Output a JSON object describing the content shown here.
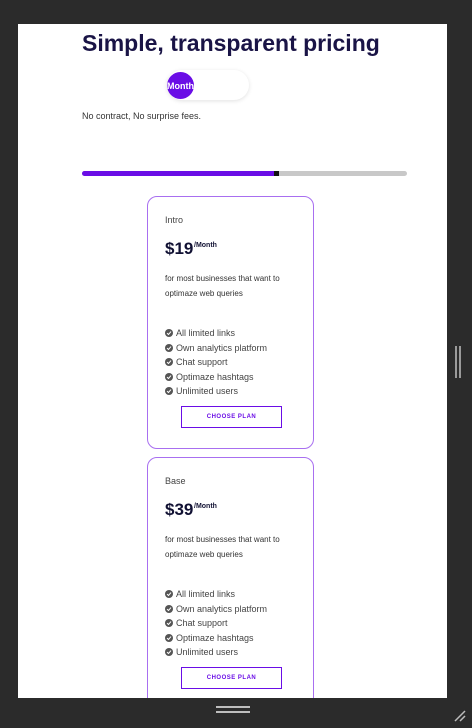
{
  "page": {
    "title": "Simple, transparent pricing",
    "toggle_label": "Month",
    "subtitle": "No contract, No surprise fees.",
    "slider_progress": 0.6
  },
  "plans": [
    {
      "name": "Intro",
      "price": "$19",
      "period": "/Month",
      "description": "for most businesses that want to optimaze web queries",
      "features": [
        "All limited links",
        "Own analytics platform",
        "Chat support",
        "Optimaze hashtags",
        "Unlimited users"
      ],
      "button_label": "CHOOSE PLAN"
    },
    {
      "name": "Base",
      "price": "$39",
      "period": "/Month",
      "description": "for most businesses that want to optimaze web queries",
      "features": [
        "All limited links",
        "Own analytics platform",
        "Chat support",
        "Optimaze hashtags",
        "Unlimited users"
      ],
      "button_label": "CHOOSE PLAN"
    }
  ],
  "colors": {
    "accent": "#6a0de6",
    "title": "#1a1446",
    "card_border": "#a86ff0",
    "track": "#c8c8c8"
  },
  "icons": {
    "feature": "check-circle-icon",
    "resize": "resize-grip-icon"
  }
}
